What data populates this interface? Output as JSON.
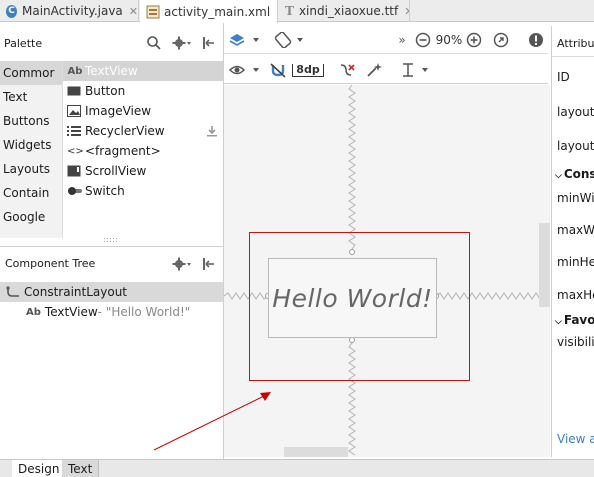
{
  "tabs": [
    {
      "label": "MainActivity.java",
      "icon": "C",
      "color": "#3f7fbf",
      "active": false
    },
    {
      "label": "activity_main.xml",
      "icon": "xml",
      "color": "#9a6b3a",
      "active": true
    },
    {
      "label": "xindi_xiaoxue.ttf",
      "icon": "T",
      "color": "#888888",
      "active": false
    }
  ],
  "palette": {
    "title": "Palette",
    "categories": [
      "Commor",
      "Text",
      "Buttons",
      "Widgets",
      "Layouts",
      "Contain",
      "Google"
    ],
    "items": [
      {
        "icon": "Ab",
        "label": "TextView"
      },
      {
        "icon": "btn",
        "label": "Button"
      },
      {
        "icon": "img",
        "label": "ImageView"
      },
      {
        "icon": "list",
        "label": "RecyclerView"
      },
      {
        "icon": "<>",
        "label": "<fragment>"
      },
      {
        "icon": "scroll",
        "label": "ScrollView"
      },
      {
        "icon": "switch",
        "label": "Switch"
      }
    ]
  },
  "component_tree": {
    "title": "Component Tree",
    "root": "ConstraintLayout",
    "child_label": "TextView",
    "child_detail": "- \"Hello World!\""
  },
  "toolbar": {
    "zoom": "90%",
    "margin": "8dp"
  },
  "canvas": {
    "text": "Hello World!"
  },
  "attributes": {
    "title": "Attribut",
    "rows": [
      "ID",
      "layout_",
      "layout_",
      "Cons",
      "minWid",
      "maxWid",
      "minHei",
      "maxHei",
      "Favo",
      "visibility"
    ],
    "view_all": "View al"
  },
  "bottom_tabs": [
    "Design",
    "Text"
  ],
  "colors": {
    "selection_red": "#cc1111",
    "arrow_red": "#cc0000"
  }
}
